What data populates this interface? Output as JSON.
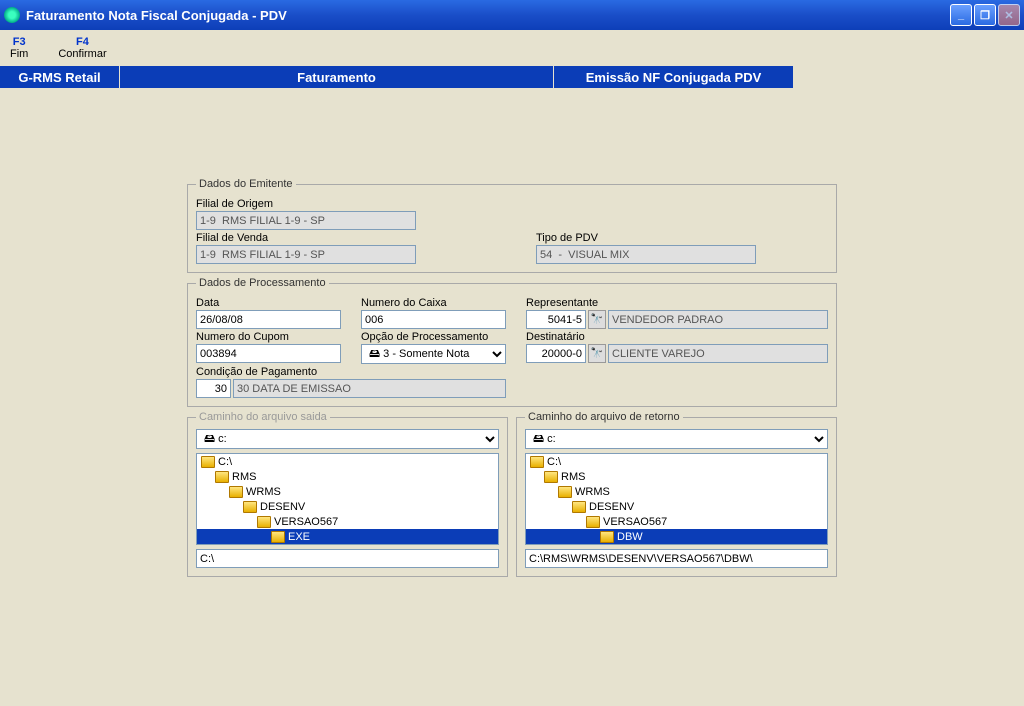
{
  "window": {
    "title": "Faturamento Nota Fiscal Conjugada - PDV"
  },
  "menu": {
    "f3": {
      "key": "F3",
      "label": "Fim"
    },
    "f4": {
      "key": "F4",
      "label": "Confirmar"
    }
  },
  "breadcrumb": {
    "b1": "G-RMS Retail",
    "b2": "Faturamento",
    "b3": "Emissão NF Conjugada PDV"
  },
  "emitente": {
    "legend": "Dados do Emitente",
    "filial_origem_label": "Filial de Origem",
    "filial_origem_value": "1-9  RMS FILIAL 1-9 - SP",
    "filial_venda_label": "Filial de Venda",
    "filial_venda_value": "1-9  RMS FILIAL 1-9 - SP",
    "tipo_pdv_label": "Tipo de PDV",
    "tipo_pdv_value": "54  -  VISUAL MIX"
  },
  "process": {
    "legend": "Dados de Processamento",
    "data_label": "Data",
    "data_value": "26/08/08",
    "numero_caixa_label": "Numero do Caixa",
    "numero_caixa_value": "006",
    "representante_label": "Representante",
    "representante_code": "5041-5",
    "representante_name": "VENDEDOR PADRAO",
    "numero_cupom_label": "Numero do Cupom",
    "numero_cupom_value": "003894",
    "opcao_label": "Opção de Processamento",
    "opcao_value": "3 - Somente Nota",
    "destinatario_label": "Destinatário",
    "destinatario_code": "20000-0",
    "destinatario_name": "CLIENTE VAREJO",
    "cond_pag_label": "Condição de Pagamento",
    "cond_pag_code": "30",
    "cond_pag_desc": "30 DATA DE EMISSAO"
  },
  "paths": {
    "saida_legend": "Caminho do arquivo saida",
    "retorno_legend": "Caminho do arquivo de retorno",
    "drive": "c:",
    "saida_folders": [
      {
        "label": "C:\\",
        "indent": 0,
        "selected": false
      },
      {
        "label": "RMS",
        "indent": 1,
        "selected": false
      },
      {
        "label": "WRMS",
        "indent": 2,
        "selected": false
      },
      {
        "label": "DESENV",
        "indent": 3,
        "selected": false
      },
      {
        "label": "VERSAO567",
        "indent": 4,
        "selected": false
      },
      {
        "label": "EXE",
        "indent": 5,
        "selected": true
      }
    ],
    "saida_path": "C:\\",
    "retorno_folders": [
      {
        "label": "C:\\",
        "indent": 0,
        "selected": false
      },
      {
        "label": "RMS",
        "indent": 1,
        "selected": false
      },
      {
        "label": "WRMS",
        "indent": 2,
        "selected": false
      },
      {
        "label": "DESENV",
        "indent": 3,
        "selected": false
      },
      {
        "label": "VERSAO567",
        "indent": 4,
        "selected": false
      },
      {
        "label": "DBW",
        "indent": 5,
        "selected": true
      }
    ],
    "retorno_path": "C:\\RMS\\WRMS\\DESENV\\VERSAO567\\DBW\\"
  }
}
